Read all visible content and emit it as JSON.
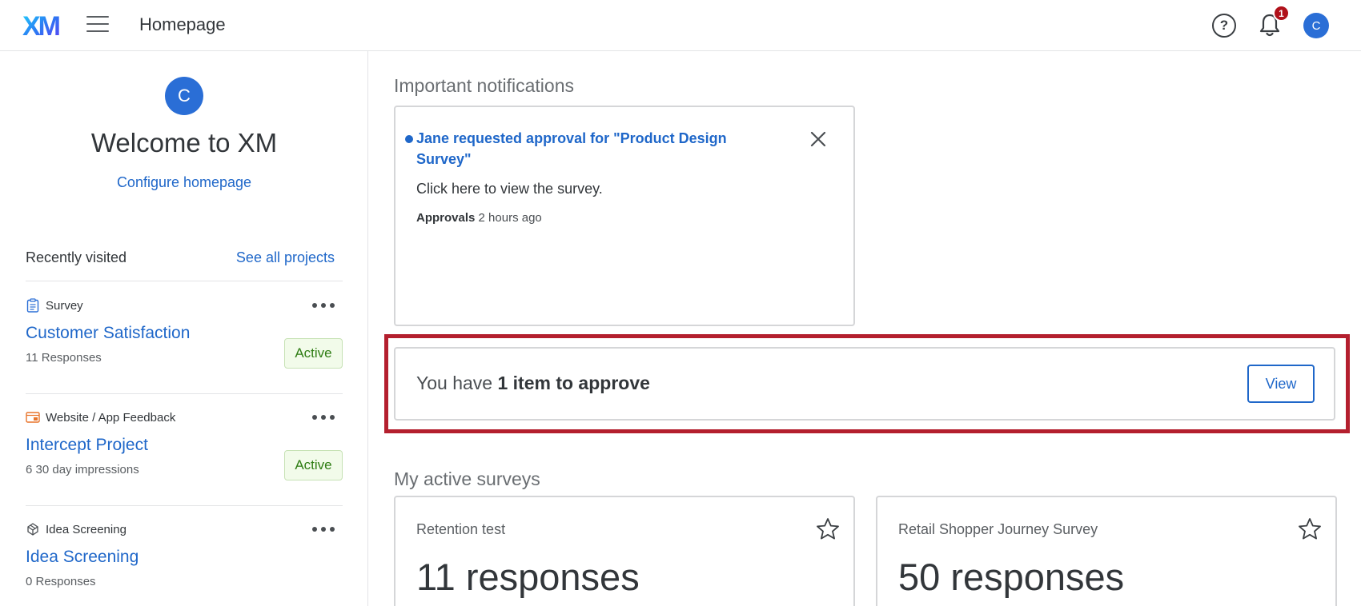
{
  "header": {
    "logo_text": "XM",
    "page_title": "Homepage",
    "help_symbol": "?",
    "notification_count": "1",
    "avatar_initial": "C"
  },
  "sidebar": {
    "avatar_initial": "C",
    "welcome": "Welcome to XM",
    "configure_link": "Configure homepage",
    "recent_label": "Recently visited",
    "see_all_link": "See all projects",
    "projects": [
      {
        "type": "Survey",
        "type_icon": "survey-icon",
        "name": "Customer Satisfaction",
        "sub": "11 Responses",
        "status": "Active"
      },
      {
        "type": "Website / App Feedback",
        "type_icon": "website-feedback-icon",
        "name": "Intercept Project",
        "sub": "6 30 day impressions",
        "status": "Active"
      },
      {
        "type": "Idea Screening",
        "type_icon": "idea-screening-icon",
        "name": "Idea Screening",
        "sub": "0 Responses",
        "status": ""
      }
    ]
  },
  "main": {
    "notifications_title": "Important notifications",
    "notification": {
      "title": "Jane requested approval for \"Product Design Survey\"",
      "body": "Click here to view the survey.",
      "category": "Approvals",
      "time": "2 hours ago"
    },
    "approve": {
      "prefix": "You have ",
      "bold": "1 item to approve",
      "button": "View"
    },
    "active_surveys_title": "My active surveys",
    "surveys": [
      {
        "name": "Retention test",
        "count": "11 responses"
      },
      {
        "name": "Retail Shopper Journey Survey",
        "count": "50 responses"
      }
    ]
  },
  "colors": {
    "accent": "#1f67c9",
    "highlight": "#b41f2e",
    "badge": "#b0111a",
    "active_green": "#2f7d14"
  }
}
